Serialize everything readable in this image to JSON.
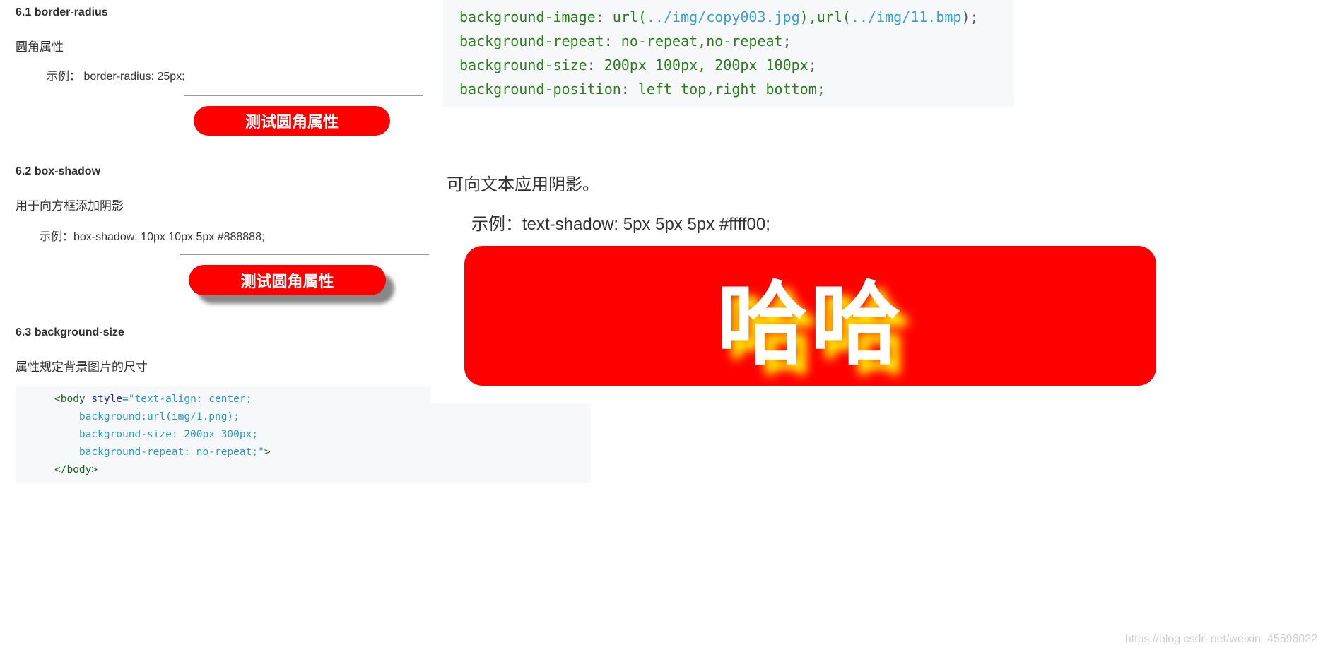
{
  "sections": [
    {
      "heading": "6.1 border-radius",
      "description": "圆角属性",
      "example": "示例： border-radius: 25px;",
      "button_label": "测试圆角属性"
    },
    {
      "heading": "6.2 box-shadow",
      "description": "用于向方框添加阴影",
      "example": "示例：box-shadow: 10px 10px 5px #888888;",
      "button_label": "测试圆角属性"
    },
    {
      "heading": "6.3 background-size",
      "description": "属性规定背景图片的尺寸",
      "code": {
        "open_tag": "<body",
        "attr_name": "style",
        "eq": "=",
        "line1_str": "\"text-align: center;",
        "line2": "background:url(img/1.png);",
        "line3": "background-size: 200px 300px;",
        "line4": "background-repeat: no-repeat;\"",
        "line4_end": ">",
        "close_tag": "</body>"
      }
    }
  ],
  "right_code": {
    "line1_prop": "background-image",
    "line1_url1_fn": "url(",
    "line1_url1": "../img/copy003.jpg",
    "line1_url1_end": "),",
    "line1_url2_fn": "url(",
    "line1_url2": "../img/11.bmp",
    "line1_end": ");",
    "line2_prop": "background-repeat",
    "line2_val": "no-repeat,no-repeat",
    "line3_prop": "background-size",
    "line3_val": "200px 100px, 200px 100px",
    "line4_prop": "background-position",
    "line4_val": "left top,right bottom",
    "colon": ":",
    "semi": ";"
  },
  "text_shadow": {
    "description": "可向文本应用阴影。",
    "example": "示例：text-shadow: 5px 5px 5px #ffff00;",
    "demo_text": "哈哈"
  },
  "watermark": "https://blog.csdn.net/weixin_45596022",
  "colors": {
    "button_red": "#ff0000",
    "shadow_yellow": "#ffff00",
    "box_shadow_gray": "#888888"
  }
}
